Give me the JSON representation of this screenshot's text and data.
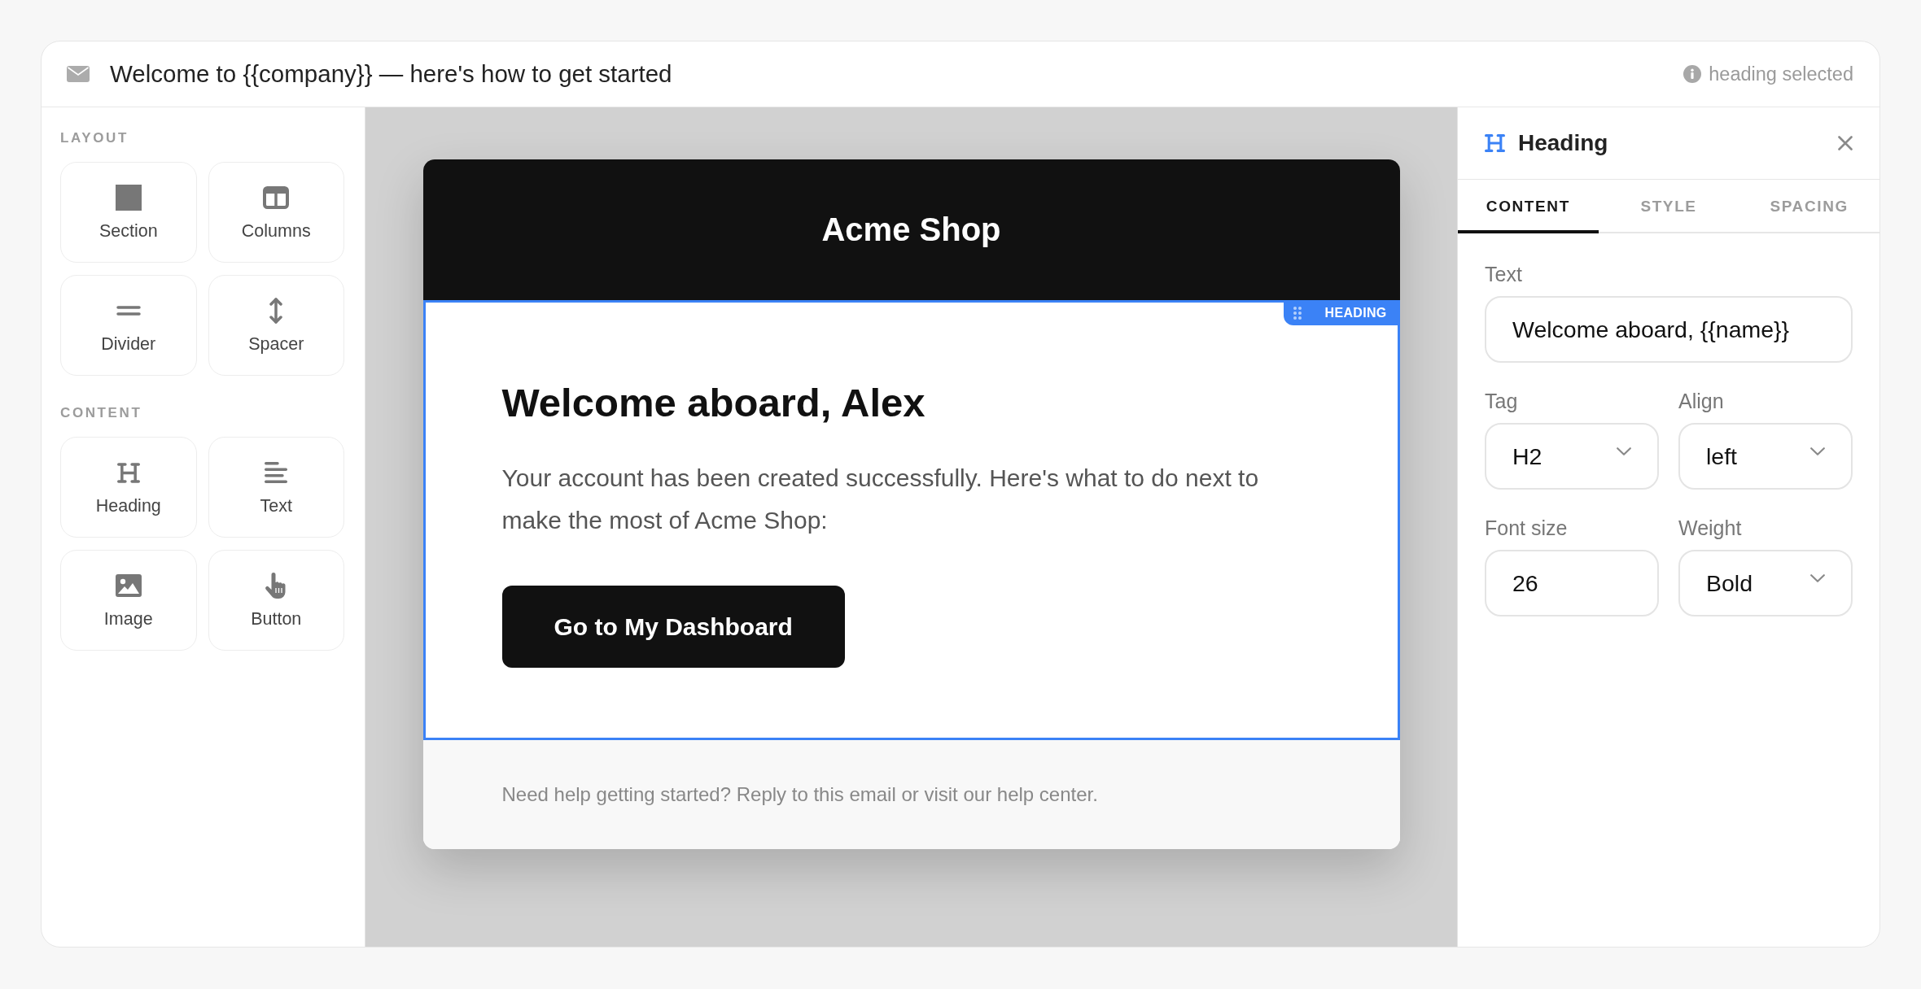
{
  "topbar": {
    "subject": "Welcome to {{company}} — here's how to get started",
    "status": "heading selected"
  },
  "sidebar": {
    "groups": [
      {
        "label": "LAYOUT",
        "blocks": [
          {
            "kind": "section",
            "label": "Section"
          },
          {
            "kind": "columns",
            "label": "Columns"
          },
          {
            "kind": "divider",
            "label": "Divider"
          },
          {
            "kind": "spacer",
            "label": "Spacer"
          }
        ]
      },
      {
        "label": "CONTENT",
        "blocks": [
          {
            "kind": "heading",
            "label": "Heading"
          },
          {
            "kind": "text",
            "label": "Text"
          },
          {
            "kind": "image",
            "label": "Image"
          },
          {
            "kind": "button",
            "label": "Button"
          }
        ]
      }
    ]
  },
  "email": {
    "sections": [
      {
        "kind": "header",
        "selected": false,
        "title": "Acme Shop"
      },
      {
        "kind": "content",
        "selected": true,
        "badge": "HEADING",
        "heading": "Welcome aboard, Alex",
        "paragraph": "Your account has been created successfully. Here's what to do next to make the most of Acme Shop:",
        "button": "Go to My Dashboard"
      },
      {
        "kind": "footer",
        "selected": false,
        "text": "Need help getting started? Reply to this email or visit our help center."
      }
    ]
  },
  "inspector": {
    "title": "Heading",
    "tabs": [
      {
        "label": "CONTENT",
        "selected": true
      },
      {
        "label": "STYLE",
        "selected": false
      },
      {
        "label": "SPACING",
        "selected": false
      }
    ],
    "rows": [
      [
        {
          "kind": "input",
          "label": "Text",
          "value": "Welcome aboard, {{name}}"
        }
      ],
      [
        {
          "kind": "select",
          "label": "Tag",
          "value": "H2"
        },
        {
          "kind": "select",
          "label": "Align",
          "value": "left"
        }
      ],
      [
        {
          "kind": "input",
          "label": "Font size",
          "value": "26"
        },
        {
          "kind": "select",
          "label": "Weight",
          "value": "Bold"
        }
      ]
    ]
  }
}
